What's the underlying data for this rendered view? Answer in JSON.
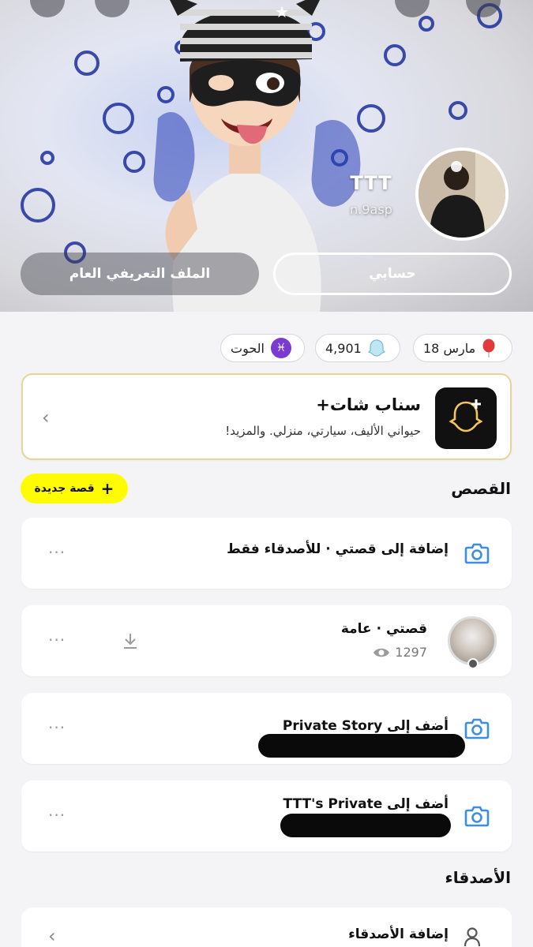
{
  "profile": {
    "display_name": "TTT",
    "username": "n.9asp",
    "tabs": {
      "account": "حسابي",
      "public_profile": "الملف التعريفي العام"
    }
  },
  "chips": {
    "birthday": "18 مارس",
    "snap_score": "4,901",
    "zodiac": "الحوت",
    "zodiac_symbol": "♓"
  },
  "snapchat_plus": {
    "title": "سناب شات+",
    "subtitle": "حيواني الأليف، سيارتي، منزلي. والمزيد!"
  },
  "stories": {
    "section_title": "القصص",
    "new_story_label": "قصة جديدة",
    "items": [
      {
        "label": "إضافة إلى قصتي · للأصدقاء فقط"
      },
      {
        "label": "قصتي · عامة",
        "views": "1297"
      },
      {
        "label": "أضف إلى Private Story"
      },
      {
        "label": "أضف إلى TTT's Private"
      }
    ]
  },
  "friends": {
    "section_title": "الأصدقاء",
    "add_friends_label": "إضافة الأصدقاء"
  },
  "colors": {
    "accent_yellow": "#fffc00",
    "camera_blue": "#3a8ee6",
    "zodiac_purple": "#7a3bd0"
  }
}
